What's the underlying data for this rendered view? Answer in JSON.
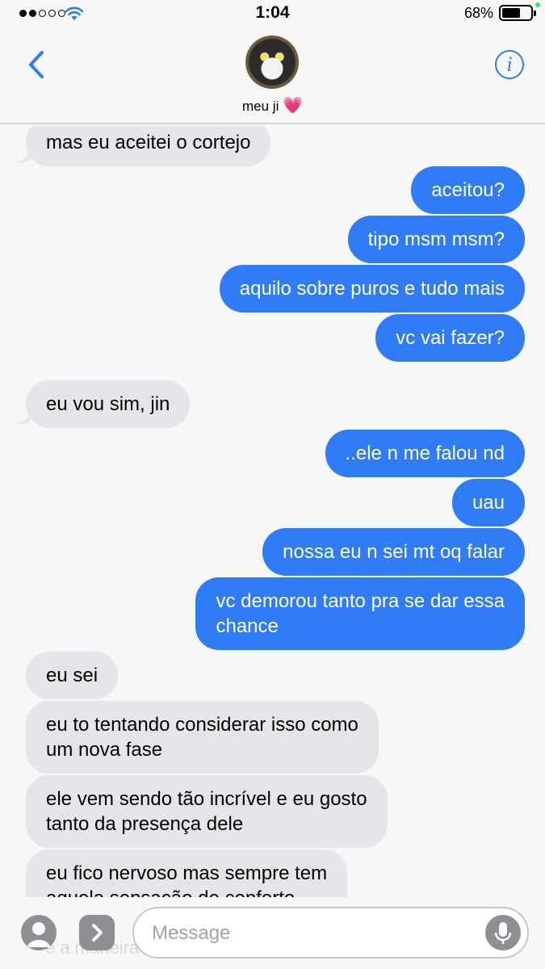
{
  "status_bar": {
    "time": "1:04",
    "battery_percent": "68%",
    "battery_level": 0.68,
    "signal_bars": 2,
    "signal_total": 5
  },
  "header": {
    "contact_name": "meu ji",
    "contact_emoji": "💗"
  },
  "messages": [
    {
      "side": "in",
      "text": "mas eu aceitei o cortejo"
    },
    {
      "side": "out",
      "text": "aceitou?"
    },
    {
      "side": "out",
      "text": "tipo msm msm?"
    },
    {
      "side": "out",
      "text": "aquilo sobre puros e tudo mais"
    },
    {
      "side": "out",
      "text": "vc vai fazer?"
    },
    {
      "side": "in",
      "text": "eu vou sim, jin"
    },
    {
      "side": "out",
      "text": "..ele n me falou nd"
    },
    {
      "side": "out",
      "text": "uau"
    },
    {
      "side": "out",
      "text": "nossa eu n sei mt oq falar"
    },
    {
      "side": "out",
      "text": "vc demorou tanto pra se dar essa\nchance"
    },
    {
      "side": "in",
      "text": "eu sei"
    },
    {
      "side": "in",
      "text": "eu to tentando considerar isso como\num nova fase"
    },
    {
      "side": "in",
      "text": "ele vem sendo tão incrível e eu gosto\ntanto da presença dele"
    },
    {
      "side": "in",
      "text": "eu fico nervoso mas sempre tem\naquela sensação de conforto"
    }
  ],
  "composer": {
    "placeholder": "Message",
    "value": "",
    "background_text": "e a maneira que ele"
  },
  "colors": {
    "accent": "#2f7cf6",
    "incoming": "#e5e5ea",
    "outgoing": "#2f7cf6",
    "charging": "#4cd964",
    "heart": "#e03c95"
  }
}
